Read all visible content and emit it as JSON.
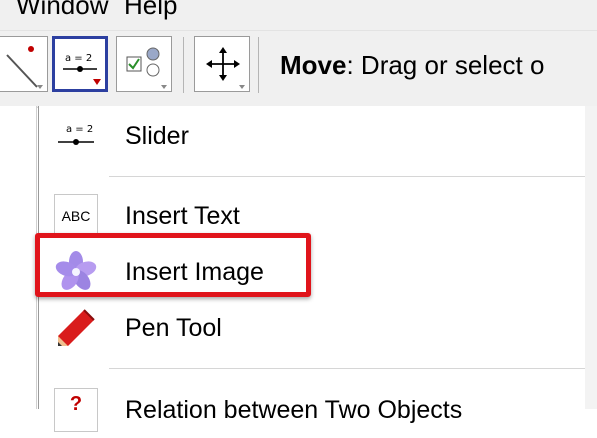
{
  "menubar": {
    "window_label": "Window",
    "help_label": "Help"
  },
  "toolbar": {
    "slider_tool_icon_text": "a = 2",
    "description_bold": "Move",
    "description_rest": ": Drag or select o"
  },
  "dropdown": {
    "items": [
      {
        "label": "Slider",
        "icon": "slider-icon",
        "icon_text": "a = 2"
      },
      {
        "label": "Insert Text",
        "icon": "text-icon",
        "icon_text": "ABC"
      },
      {
        "label": "Insert Image",
        "icon": "image-icon"
      },
      {
        "label": "Pen Tool",
        "icon": "pen-icon"
      },
      {
        "label": "Relation between Two Objects",
        "icon": "relation-icon",
        "icon_text": "?"
      }
    ]
  },
  "colors": {
    "highlight": "#e0141b",
    "selected_tool_border": "#2c3fa0",
    "image_icon": "#a38be8"
  }
}
